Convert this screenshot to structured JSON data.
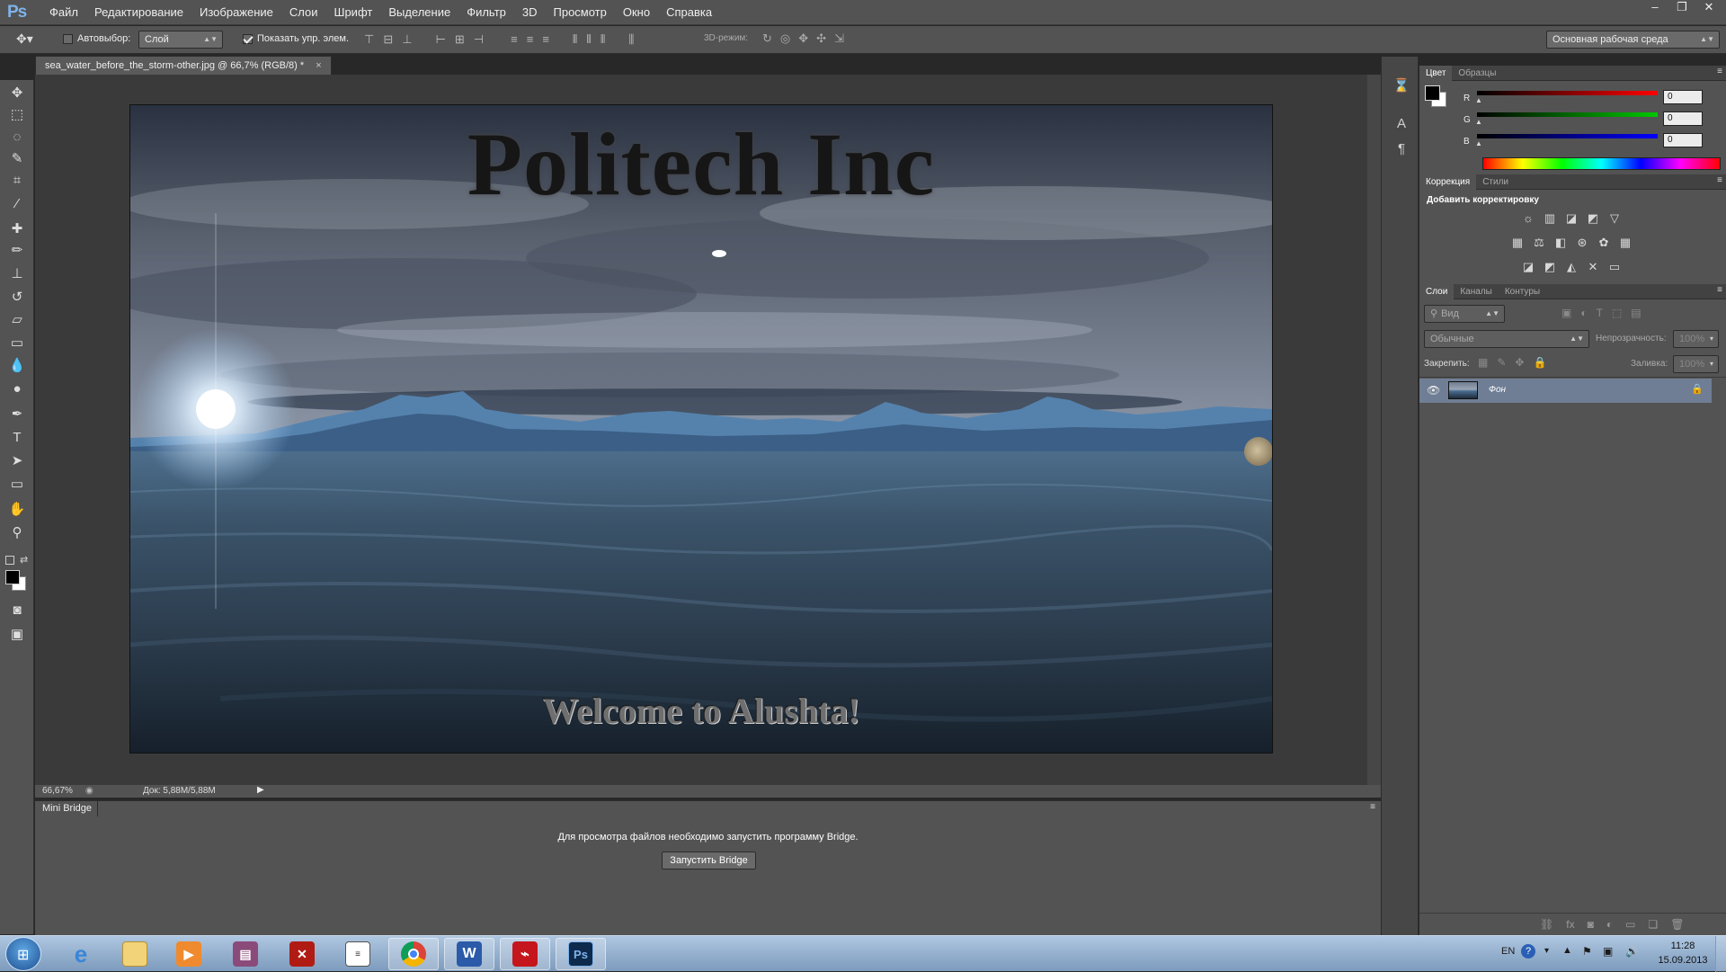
{
  "app": {
    "logo": "Ps"
  },
  "menu": [
    "Файл",
    "Редактирование",
    "Изображение",
    "Слои",
    "Шрифт",
    "Выделение",
    "Фильтр",
    "3D",
    "Просмотр",
    "Окно",
    "Справка"
  ],
  "window_controls": {
    "minimize": "–",
    "restore": "❐",
    "close": "✕"
  },
  "options_bar": {
    "autoselect_label": "Автовыбор:",
    "autoselect_value": "Слой",
    "show_transform_label": "Показать упр. элем.",
    "mode3d_label": "3D-режим:",
    "workspace": "Основная рабочая среда"
  },
  "document": {
    "tab_title": "sea_water_before_the_storm-other.jpg @ 66,7% (RGB/8) *",
    "tab_close": "×",
    "canvas_title": "Politech Inc",
    "canvas_subtitle": "Welcome to Alushta!"
  },
  "statusbar": {
    "zoom": "66,67%",
    "doc_info": "Док: 5,88M/5,88M"
  },
  "mini_bridge": {
    "tab": "Mini Bridge",
    "message": "Для просмотра файлов необходимо запустить программу Bridge.",
    "button": "Запустить Bridge"
  },
  "color_panel": {
    "tabs": [
      "Цвет",
      "Образцы"
    ],
    "channels": [
      {
        "label": "R",
        "value": "0",
        "color": "#ff0000"
      },
      {
        "label": "G",
        "value": "0",
        "color": "#00c800"
      },
      {
        "label": "B",
        "value": "0",
        "color": "#0000ff"
      }
    ]
  },
  "correction_panel": {
    "tabs": [
      "Коррекция",
      "Стили"
    ],
    "heading": "Добавить корректировку"
  },
  "layers_panel": {
    "tabs": [
      "Слои",
      "Каналы",
      "Контуры"
    ],
    "filter": "Вид",
    "blend_mode": "Обычные",
    "opacity_label": "Непрозрачность:",
    "opacity_value": "100%",
    "lock_label": "Закрепить:",
    "fill_label": "Заливка:",
    "fill_value": "100%",
    "layers": [
      {
        "name": "Фон"
      }
    ]
  },
  "taskbar": {
    "apps": [
      "Internet Explorer",
      "Проводник",
      "Медиаплеер",
      "WinRAR",
      "Dota 2",
      "Блокнот",
      "Google Chrome",
      "Microsoft Word",
      "Adobe Reader",
      "Adobe Photoshop"
    ],
    "lang": "EN",
    "time": "11:28",
    "date": "15.09.2013"
  },
  "colors": {
    "ui_dark": "#535353",
    "canvas_bg": "#282828",
    "accent": "#7fb3ea",
    "layer_selected": "#6f7e95"
  }
}
